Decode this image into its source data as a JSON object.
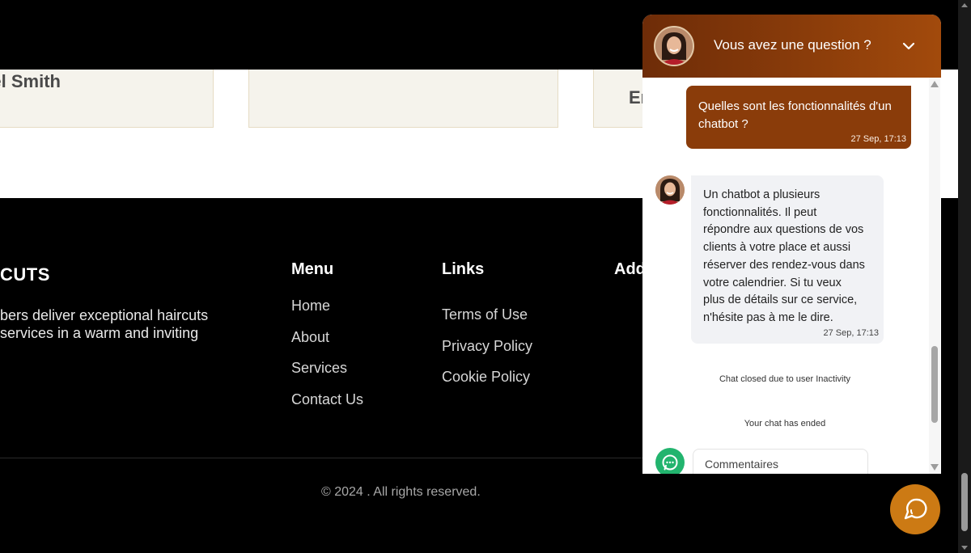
{
  "testimonials": {
    "cards": [
      {
        "name": "el Smith"
      },
      {
        "name": ""
      },
      {
        "name": "Er"
      }
    ]
  },
  "footer": {
    "brand": {
      "name": "CUTS",
      "description_lines": [
        "bers deliver exceptional haircuts",
        "services in a warm and inviting"
      ]
    },
    "menu": {
      "title": "Menu",
      "items": [
        "Home",
        "About",
        "Services",
        "Contact Us"
      ]
    },
    "links": {
      "title": "Links",
      "items": [
        "Terms of Use",
        "Privacy Policy",
        "Cookie Policy"
      ]
    },
    "address": {
      "title": "Add"
    },
    "copyright": "© 2024 . All rights reserved."
  },
  "chat": {
    "header_title": "Vous avez une question ?",
    "user_message": {
      "text": "Quelles sont les fonctionnalités d'un chatbot ?",
      "time": "27 Sep, 17:13"
    },
    "bot_message": {
      "lines": [
        "Un chatbot a plusieurs",
        "fonctionnalités. Il peut",
        "répondre aux questions de vos",
        "clients à votre place et aussi",
        "réserver des rendez-vous dans",
        "votre calendrier. Si tu veux",
        "plus de détails sur ce service,",
        "n'hésite pas à me le dire."
      ],
      "time": "27 Sep, 17:13"
    },
    "system_messages": [
      "Chat closed due to user Inactivity",
      "Your chat has ended"
    ],
    "comment_placeholder": "Commentaires"
  },
  "colors": {
    "header_brown": "#8a3c0a",
    "user_bubble": "#8a3c0a",
    "bot_bubble": "#f1f2f5",
    "launcher": "#cc7a14",
    "whatsapp_green": "#22b46e"
  },
  "icons": {
    "chevron": "chevron-down-icon",
    "whatsapp": "whatsapp-icon",
    "launcher": "chat-bubble-icon"
  }
}
